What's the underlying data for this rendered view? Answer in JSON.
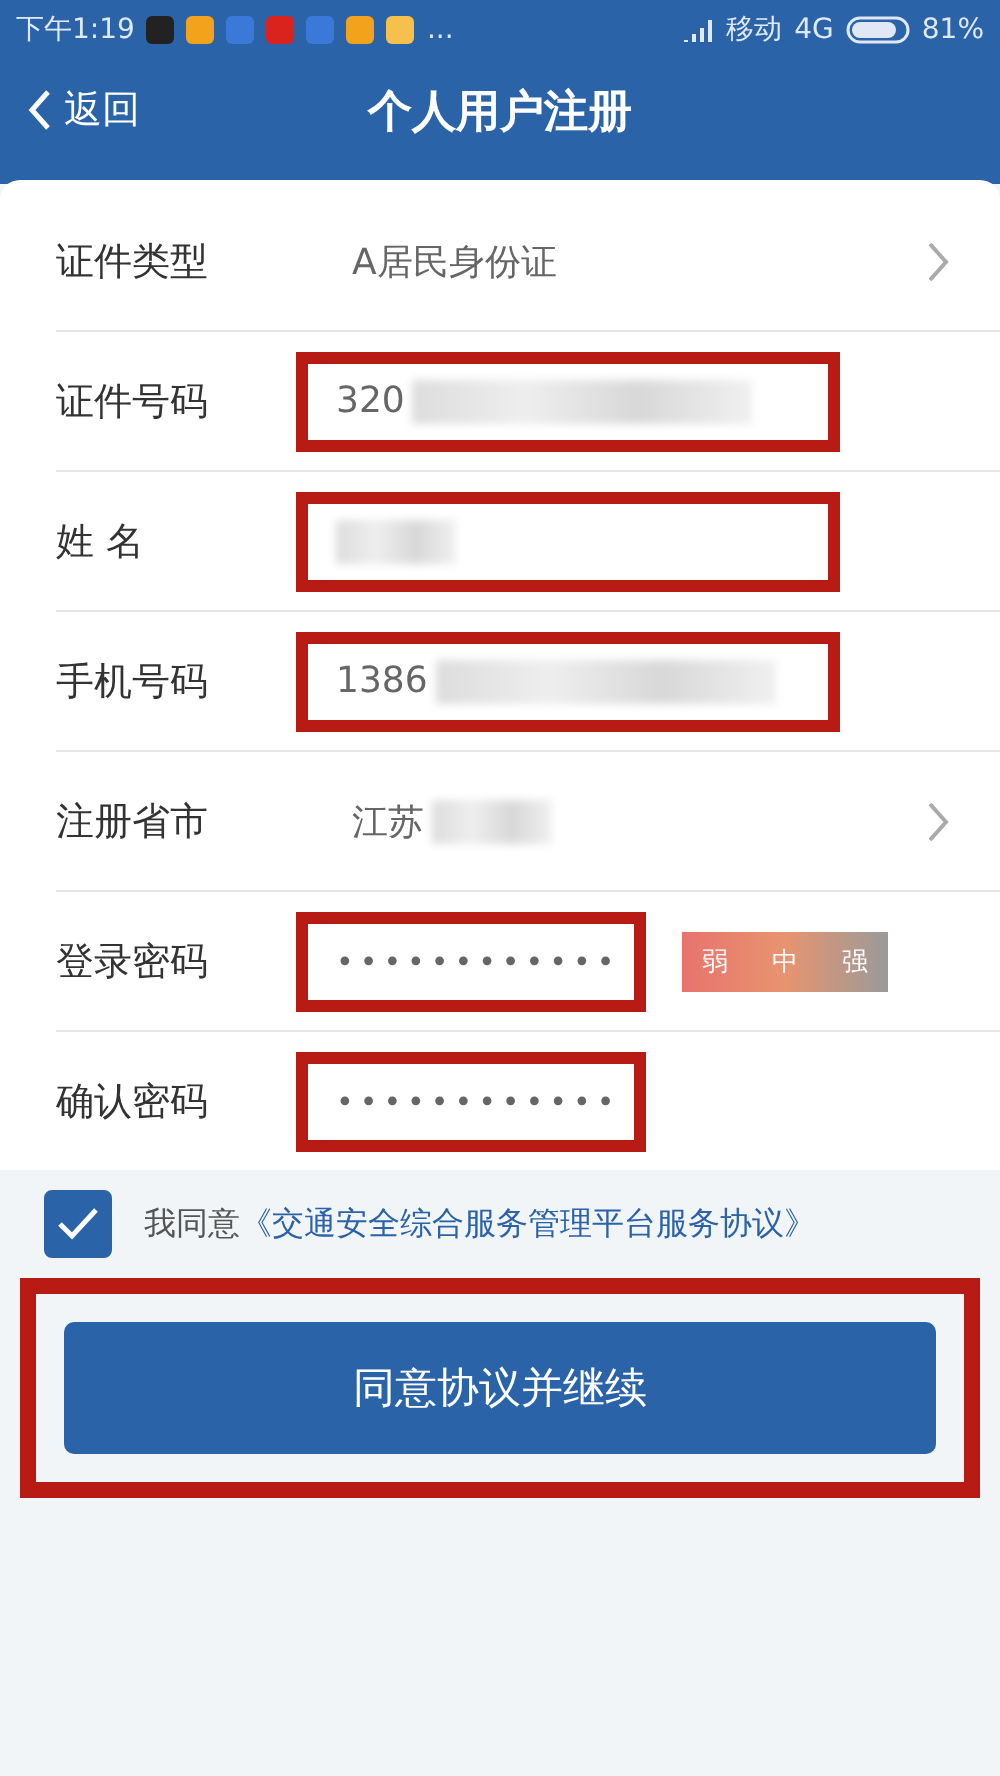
{
  "status_bar": {
    "time": "下午1:19",
    "notification_overflow": "...",
    "carrier": "移动",
    "network": "4G",
    "battery": "81%"
  },
  "header": {
    "back": "返回",
    "title": "个人用户注册"
  },
  "rows": [
    {
      "kind": "select",
      "label": "证件类型",
      "value": "A居民身份证",
      "blurred": false,
      "highlighted": false
    },
    {
      "kind": "text",
      "label": "证件号码",
      "value": "320",
      "blurred": true,
      "highlighted": true
    },
    {
      "kind": "text",
      "label": "姓 名",
      "value": "",
      "blurred": true,
      "highlighted": true
    },
    {
      "kind": "text",
      "label": "手机号码",
      "value": "1386",
      "blurred": true,
      "highlighted": true
    },
    {
      "kind": "select",
      "label": "注册省市",
      "value": "江苏",
      "blurred": true,
      "highlighted": false
    },
    {
      "kind": "password",
      "label": "登录密码",
      "value": "••••••••••••",
      "blurred": false,
      "highlighted": true,
      "strength": [
        "弱",
        "中",
        "强"
      ]
    },
    {
      "kind": "password",
      "label": "确认密码",
      "value": "••••••••••••",
      "blurred": false,
      "highlighted": true
    }
  ],
  "agreement": {
    "checked": true,
    "prefix": "我同意",
    "link": "《交通安全综合服务管理平台服务协议》"
  },
  "submit": {
    "label": "同意协议并继续",
    "highlighted": true
  }
}
